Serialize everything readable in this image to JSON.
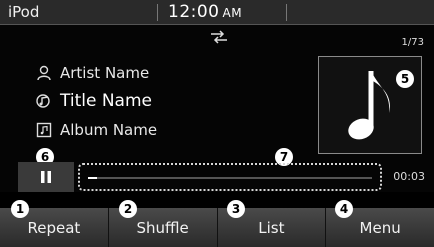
{
  "status": {
    "source": "iPod",
    "time": "12:00",
    "ampm": "AM"
  },
  "main": {
    "track_counter": "1/73",
    "repeat_indicator_icon": "repeat-indicator-icon"
  },
  "track": {
    "artist": "Artist Name",
    "title": "Title Name",
    "album": "Album Name"
  },
  "playback": {
    "state_icon": "pause-icon",
    "elapsed": "00:03",
    "progress_fraction": 0.03
  },
  "callouts": {
    "c1": "1",
    "c2": "2",
    "c3": "3",
    "c4": "4",
    "c5": "5",
    "c6": "6",
    "c7": "7"
  },
  "softkeys": [
    {
      "label": "Repeat"
    },
    {
      "label": "Shuffle"
    },
    {
      "label": "List"
    },
    {
      "label": "Menu"
    }
  ],
  "colors": {
    "background": "#000000",
    "softkey": "#3a3a3a",
    "text": "#e6e6e6",
    "badge": "#ffffff"
  }
}
